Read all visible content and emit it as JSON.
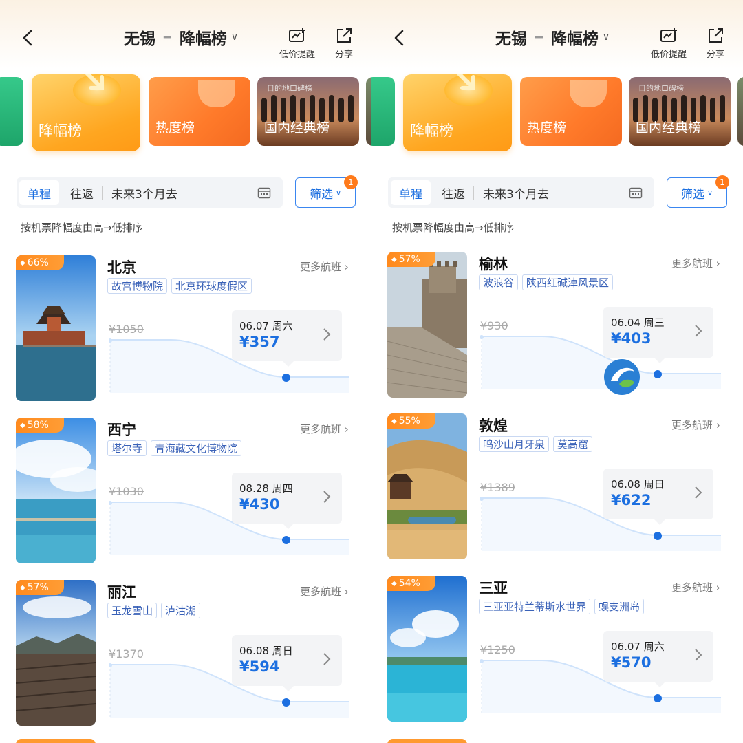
{
  "screens": [
    {
      "nav": {
        "origin": "无锡",
        "board": "降幅榜",
        "alert_label": "低价提醒",
        "share_label": "分享"
      },
      "rank_tabs": [
        {
          "label": "降幅榜"
        },
        {
          "label": "热度榜"
        },
        {
          "label": "国内经典榜",
          "badge": "目的地口碑榜"
        }
      ],
      "filter": {
        "one_way": "单程",
        "round_trip": "往返",
        "date_range": "未来3个月去",
        "filter_label": "筛选",
        "filter_count": "1"
      },
      "sort_note": "按机票降幅度由高→低排序",
      "more_flights_label": "更多航班",
      "items": [
        {
          "percent": "66%",
          "city": "北京",
          "tags": [
            "故宫博物院",
            "北京环球度假区"
          ],
          "old_price": "¥1050",
          "date": "06.07 周六",
          "price": "¥357"
        },
        {
          "percent": "58%",
          "city": "西宁",
          "tags": [
            "塔尔寺",
            "青海藏文化博物院"
          ],
          "old_price": "¥1030",
          "date": "08.28 周四",
          "price": "¥430"
        },
        {
          "percent": "57%",
          "city": "丽江",
          "tags": [
            "玉龙雪山",
            "泸沽湖"
          ],
          "old_price": "¥1370",
          "date": "06.08 周日",
          "price": "¥594"
        }
      ]
    },
    {
      "nav": {
        "origin": "无锡",
        "board": "降幅榜",
        "alert_label": "低价提醒",
        "share_label": "分享"
      },
      "rank_tabs": [
        {
          "label": "降幅榜"
        },
        {
          "label": "热度榜"
        },
        {
          "label": "国内经典榜",
          "badge": "目的地口碑榜"
        }
      ],
      "filter": {
        "one_way": "单程",
        "round_trip": "往返",
        "date_range": "未来3个月去",
        "filter_label": "筛选",
        "filter_count": "1"
      },
      "sort_note": "按机票降幅度由高→低排序",
      "more_flights_label": "更多航班",
      "items": [
        {
          "percent": "57%",
          "city": "榆林",
          "tags": [
            "波浪谷",
            "陕西红碱淖风景区"
          ],
          "old_price": "¥930",
          "date": "06.04 周三",
          "price": "¥403"
        },
        {
          "percent": "55%",
          "city": "敦煌",
          "tags": [
            "鸣沙山月牙泉",
            "莫高窟"
          ],
          "old_price": "¥1389",
          "date": "06.08 周日",
          "price": "¥622"
        },
        {
          "percent": "54%",
          "city": "三亚",
          "tags": [
            "三亚亚特兰蒂斯水世界",
            "蜈支洲岛"
          ],
          "old_price": "¥1250",
          "date": "06.07 周六",
          "price": "¥570"
        }
      ]
    }
  ],
  "colors": {
    "accent_blue": "#1c6fe0",
    "badge_orange": "#ff8a1e"
  },
  "icons": [
    "back-icon",
    "price-alert-icon",
    "share-icon",
    "calendar-icon",
    "chevron-right-icon",
    "gem-icon"
  ]
}
